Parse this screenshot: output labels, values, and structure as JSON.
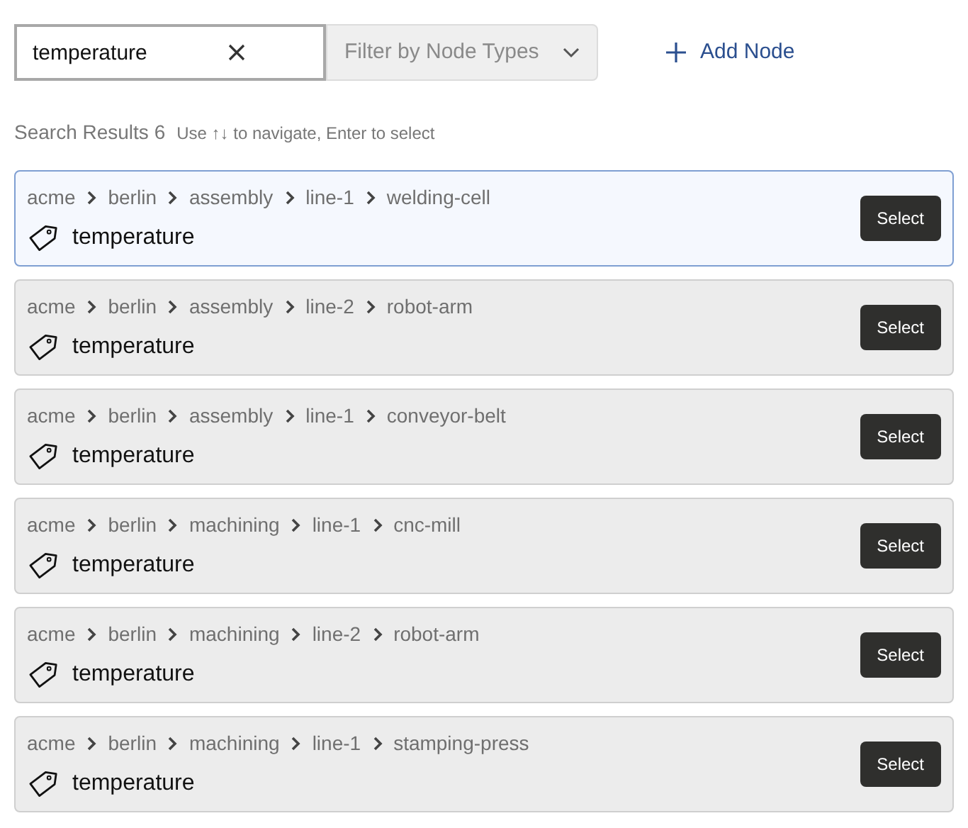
{
  "search": {
    "value": "temperature"
  },
  "filter": {
    "placeholder": "Filter by Node Types"
  },
  "add_button": {
    "label": "Add Node"
  },
  "results_header": {
    "title": "Search Results",
    "count": "6",
    "hint": "Use ↑↓ to navigate, Enter to select"
  },
  "results": [
    {
      "path": [
        "acme",
        "berlin",
        "assembly",
        "line-1",
        "welding-cell"
      ],
      "name": "temperature",
      "selected": true,
      "button": "Select"
    },
    {
      "path": [
        "acme",
        "berlin",
        "assembly",
        "line-2",
        "robot-arm"
      ],
      "name": "temperature",
      "selected": false,
      "button": "Select"
    },
    {
      "path": [
        "acme",
        "berlin",
        "assembly",
        "line-1",
        "conveyor-belt"
      ],
      "name": "temperature",
      "selected": false,
      "button": "Select"
    },
    {
      "path": [
        "acme",
        "berlin",
        "machining",
        "line-1",
        "cnc-mill"
      ],
      "name": "temperature",
      "selected": false,
      "button": "Select"
    },
    {
      "path": [
        "acme",
        "berlin",
        "machining",
        "line-2",
        "robot-arm"
      ],
      "name": "temperature",
      "selected": false,
      "button": "Select"
    },
    {
      "path": [
        "acme",
        "berlin",
        "machining",
        "line-1",
        "stamping-press"
      ],
      "name": "temperature",
      "selected": false,
      "button": "Select"
    }
  ]
}
